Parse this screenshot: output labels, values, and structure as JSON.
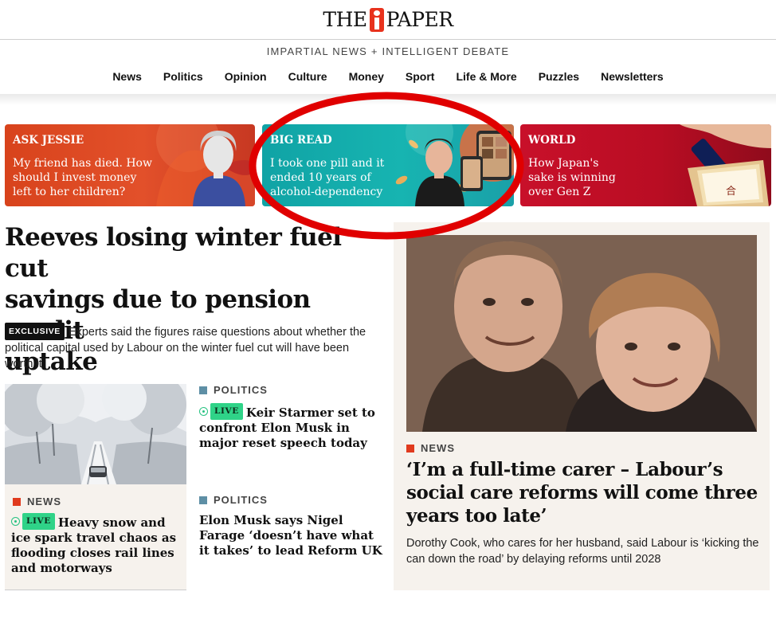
{
  "masthead": {
    "logo_left": "THE",
    "logo_right": "PAPER",
    "tagline": "IMPARTIAL NEWS + INTELLIGENT DEBATE"
  },
  "nav": [
    {
      "label": "News"
    },
    {
      "label": "Politics"
    },
    {
      "label": "Opinion"
    },
    {
      "label": "Culture"
    },
    {
      "label": "Money"
    },
    {
      "label": "Sport"
    },
    {
      "label": "Life & More"
    },
    {
      "label": "Puzzles"
    },
    {
      "label": "Newsletters"
    }
  ],
  "promos": [
    {
      "kicker": "ASK JESSIE",
      "title_lines": [
        "My friend has died. How",
        "should I invest money",
        "left to her children?"
      ]
    },
    {
      "kicker": "BIG READ",
      "title_lines": [
        "I took one pill and it",
        "ended 10 years of",
        "alcohol-dependency"
      ]
    },
    {
      "kicker": "WORLD",
      "title_lines": [
        "How Japan's",
        "sake is winning",
        "over Gen Z"
      ]
    }
  ],
  "lead": {
    "title_lines": [
      "Reeves losing winter fuel cut",
      "savings due to pension credit",
      "uptake"
    ],
    "badge": "EXCLUSIVE",
    "body": "Experts said the figures raise questions about whether the political capital used by Labour on the winter fuel cut will have been worth it"
  },
  "story_snow": {
    "section": "NEWS",
    "live": "LIVE",
    "title": "Heavy snow and ice spark travel chaos as flooding closes rail lines and motorways"
  },
  "story_starmer": {
    "section": "POLITICS",
    "live": "LIVE",
    "title": "Keir Starmer set to confront Elon Musk in major reset speech today"
  },
  "story_musk": {
    "section": "POLITICS",
    "title": "Elon Musk says Nigel Farage ‘doesn’t have what it takes’ to lead Reform UK"
  },
  "feature": {
    "section": "NEWS",
    "title": "‘I’m a full-time carer – Labour’s social care reforms will come three years too late’",
    "body": "Dorothy Cook, who cares for her husband, said Labour is ‘kicking the can down the road’ by delaying reforms until 2028"
  },
  "colors": {
    "brand_red": "#e8321d",
    "annotation_ring": "#e00000",
    "live_green": "#2fd388"
  }
}
